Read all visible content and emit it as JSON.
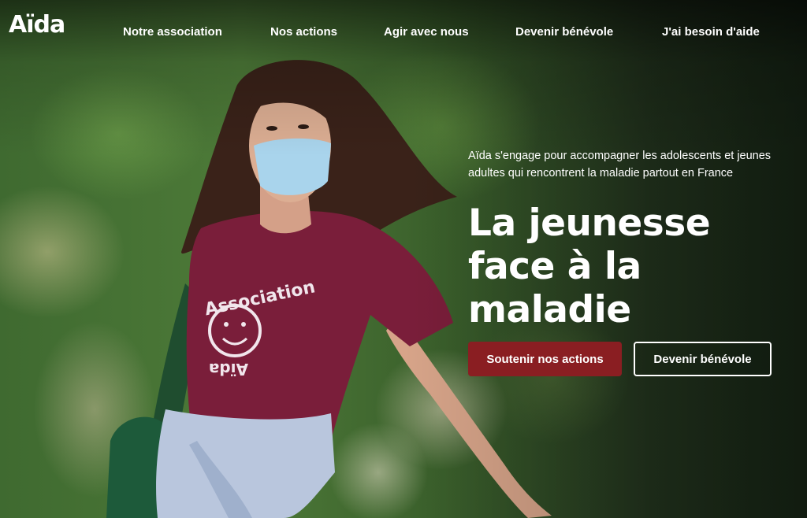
{
  "brand": {
    "logo_text": "Aïda"
  },
  "nav": {
    "items": [
      {
        "label": "Notre association"
      },
      {
        "label": "Nos actions"
      },
      {
        "label": "Agir avec nous"
      },
      {
        "label": "Devenir bénévole"
      },
      {
        "label": "J'ai besoin d'aide"
      }
    ]
  },
  "hero": {
    "intro": "Aïda s'engage pour accompagner les adolescents et jeunes adultes qui rencontrent la maladie partout en France",
    "headline": "La jeunesse face à la maladie",
    "primary_button": "Soutenir nos actions",
    "secondary_button": "Devenir bénévole",
    "shirt_text_top": "Association",
    "shirt_text_bottom": "Aïda"
  },
  "colors": {
    "primary_button": "#8a1e22",
    "shirt": "#7a1e3a",
    "mask": "#a9d4ec"
  }
}
